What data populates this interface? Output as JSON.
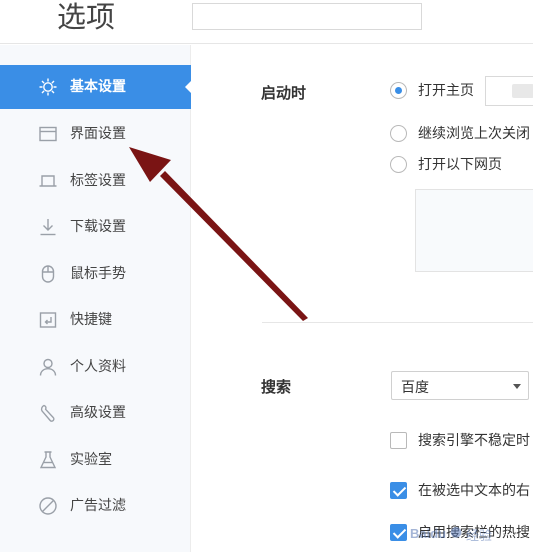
{
  "header": {
    "title": "选项",
    "search_placeholder": ""
  },
  "sidebar": {
    "items": [
      {
        "label": "基本设置",
        "icon": "gear-icon",
        "active": true
      },
      {
        "label": "界面设置",
        "icon": "window-icon",
        "active": false
      },
      {
        "label": "标签设置",
        "icon": "tab-icon",
        "active": false
      },
      {
        "label": "下载设置",
        "icon": "download-icon",
        "active": false
      },
      {
        "label": "鼠标手势",
        "icon": "mouse-icon",
        "active": false
      },
      {
        "label": "快捷键",
        "icon": "keyboard-shortcut-icon",
        "active": false
      },
      {
        "label": "个人资料",
        "icon": "person-icon",
        "active": false
      },
      {
        "label": "高级设置",
        "icon": "wrench-icon",
        "active": false
      },
      {
        "label": "实验室",
        "icon": "flask-icon",
        "active": false
      },
      {
        "label": "广告过滤",
        "icon": "block-icon",
        "active": false
      }
    ]
  },
  "startup": {
    "label": "启动时",
    "options": [
      {
        "label": "打开主页",
        "checked": true
      },
      {
        "label": "继续浏览上次关闭",
        "checked": false
      },
      {
        "label": "打开以下网页",
        "checked": false
      }
    ]
  },
  "search": {
    "label": "搜索",
    "engine": "百度",
    "checkboxes": [
      {
        "label": "搜索引擎不稳定时",
        "checked": false
      },
      {
        "label": "在被选中文本的右",
        "checked": true
      },
      {
        "label": "启用搜索栏的热搜",
        "checked": true
      }
    ]
  },
  "watermark": {
    "text": "经验",
    "brand": "Baidu"
  },
  "colors": {
    "accent": "#3a8ee6",
    "arrow": "#7a1414"
  }
}
